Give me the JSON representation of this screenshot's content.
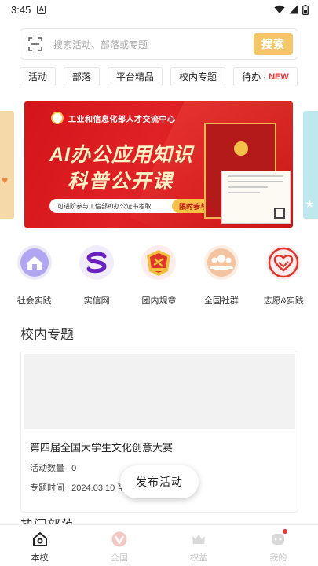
{
  "status_bar": {
    "time": "3:45",
    "app_icon": "A"
  },
  "search": {
    "placeholder": "搜索活动、部落或专题",
    "button_label": "搜索"
  },
  "tabs": [
    {
      "label": "活动"
    },
    {
      "label": "部落"
    },
    {
      "label": "平台精品"
    },
    {
      "label": "校内专题"
    },
    {
      "label": "待办",
      "dot": "·",
      "badge": "NEW"
    }
  ],
  "banner": {
    "org": "工业和信息化部人才交流中心",
    "title_line1": "AI办公应用知识",
    "title_line2": "科普公开课",
    "pill_text": "可进阶参与工信部AI办公证书考取",
    "pill_tag": "限时参与"
  },
  "quick_icons": [
    {
      "label": "社会实践",
      "icon": "house-icon",
      "color": "#a89af0"
    },
    {
      "label": "实信网",
      "icon": "s-logo-icon",
      "color": "#6a1fc0"
    },
    {
      "label": "团内规章",
      "icon": "league-badge-icon",
      "color": "#e0342a"
    },
    {
      "label": "全国社群",
      "icon": "people-icon",
      "color": "#f2b48a"
    },
    {
      "label": "志愿&实践",
      "icon": "heart-hands-icon",
      "color": "#e0342a"
    }
  ],
  "section": {
    "title": "校内专题",
    "next_title_peek": "热门部落"
  },
  "card": {
    "title": "第四届全国大学生文化创意大赛",
    "count": "活动数量 : 0",
    "time": "专题时间 : 2024.03.10 至"
  },
  "fab": {
    "label": "发布活动"
  },
  "bottom_nav": [
    {
      "label": "本校",
      "icon": "home-icon",
      "active": true
    },
    {
      "label": "全国",
      "icon": "v-logo-icon",
      "active": false
    },
    {
      "label": "权益",
      "icon": "crown-icon",
      "active": false
    },
    {
      "label": "我的",
      "icon": "profile-icon",
      "active": false,
      "badge": true
    }
  ],
  "colors": {
    "accent": "#f5c56a",
    "badge_red": "#e33333",
    "banner_red": "#d3151b"
  }
}
